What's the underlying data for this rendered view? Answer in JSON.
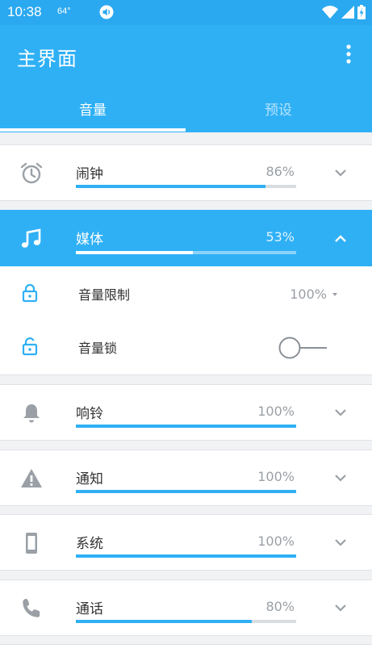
{
  "status_bar": {
    "time": "10:38",
    "temperature": "64°"
  },
  "app_bar": {
    "title": "主界面"
  },
  "tabs": [
    {
      "label": "音量",
      "selected": true
    },
    {
      "label": "预设",
      "selected": false
    }
  ],
  "streams": [
    {
      "label": "闹钟",
      "percent_text": "86%",
      "level": 0.86,
      "icon": "alarm-clock-icon",
      "expanded": false
    },
    {
      "label": "媒体",
      "percent_text": "53%",
      "level": 0.53,
      "icon": "music-note-icon",
      "expanded": true
    },
    {
      "label": "响铃",
      "percent_text": "100%",
      "level": 1.0,
      "icon": "bell-icon",
      "expanded": false
    },
    {
      "label": "通知",
      "percent_text": "100%",
      "level": 1.0,
      "icon": "warning-icon",
      "expanded": false
    },
    {
      "label": "系统",
      "percent_text": "100%",
      "level": 1.0,
      "icon": "phone-device-icon",
      "expanded": false
    },
    {
      "label": "通话",
      "percent_text": "80%",
      "level": 0.8,
      "icon": "phone-call-icon",
      "expanded": false
    }
  ],
  "media_options": {
    "volume_limit": {
      "label": "音量限制",
      "value": "100%"
    },
    "volume_lock": {
      "label": "音量锁",
      "on": false
    }
  },
  "colors": {
    "accent": "#2fb0f5",
    "status_bar": "#2aa9f0",
    "icon_gray": "#9aa0a6",
    "track": "#d9dde1"
  }
}
